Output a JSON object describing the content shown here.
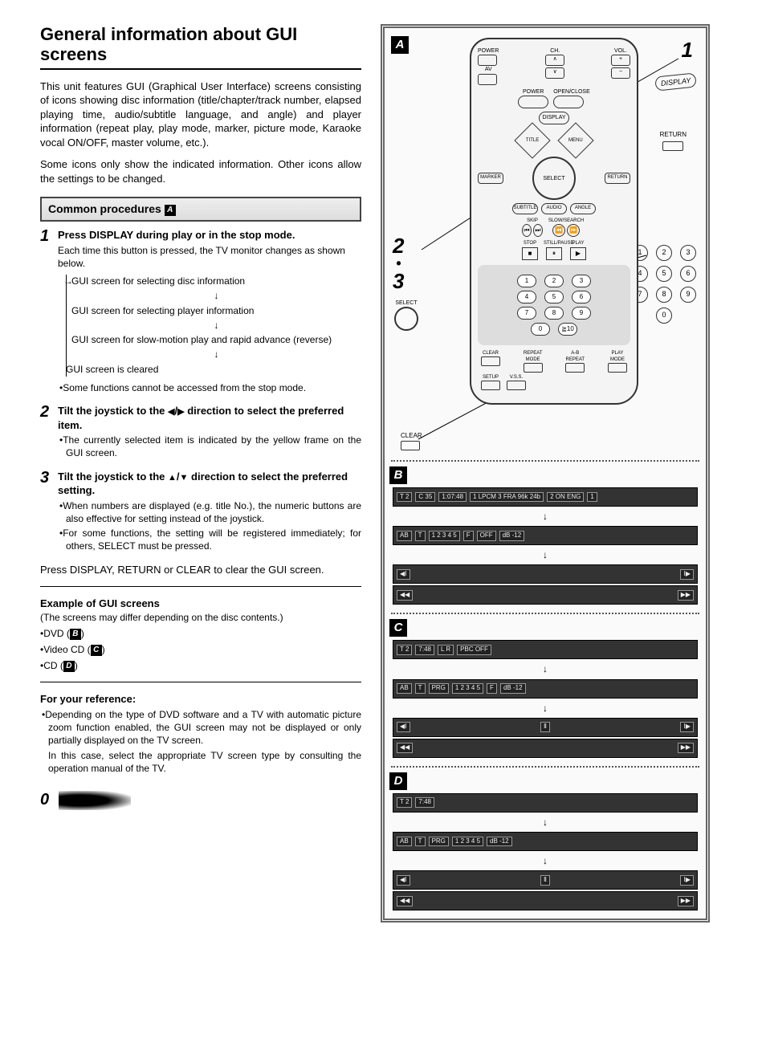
{
  "title_line1": "General information about GUI",
  "title_line2": "screens",
  "intro1": "This unit features GUI (Graphical User Interface) screens consisting of icons showing disc information (title/chapter/track number, elapsed playing time, audio/subtitle language, and angle) and player information (repeat play, play mode, marker, picture mode, Karaoke vocal ON/OFF, master volume, etc.).",
  "intro2": "Some icons only show the indicated information. Other icons allow the settings to be changed.",
  "section_header": "Common procedures",
  "section_badge": "A",
  "steps": [
    {
      "num": "1",
      "head": "Press DISPLAY during play or in the stop mode.",
      "sub": "Each time this button is pressed, the TV monitor changes as shown below.",
      "flow": [
        "GUI screen for selecting disc information",
        "GUI screen for selecting player information",
        "GUI screen for slow-motion play and rapid advance (reverse)",
        "GUI screen is cleared"
      ],
      "note": "Some functions cannot be accessed from the stop mode."
    },
    {
      "num": "2",
      "head_a": "Tilt the joystick to the ",
      "head_b": " direction to select the preferred item.",
      "note": "The currently selected item is indicated by the yellow frame on the GUI screen."
    },
    {
      "num": "3",
      "head_a": "Tilt the joystick to the ",
      "head_b": " direction to select the preferred setting.",
      "notes": [
        "When numbers are displayed (e.g. title No.), the numeric buttons are also effective for setting instead of the joystick.",
        "For some functions, the setting will be registered immediately; for others, SELECT must be pressed."
      ]
    }
  ],
  "press_clear": "Press DISPLAY, RETURN or CLEAR to clear the GUI screen.",
  "example_head": "Example of GUI screens",
  "example_note": "(The screens may differ depending on the disc contents.)",
  "examples": [
    {
      "label": "DVD",
      "ref": "B"
    },
    {
      "label": "Video CD",
      "ref": "C"
    },
    {
      "label": "CD",
      "ref": "D"
    }
  ],
  "ref_head": "For your reference:",
  "ref_body1": "Depending on the type of DVD software and a TV with automatic picture zoom function enabled, the GUI screen may not be displayed or only partially displayed on the TV screen.",
  "ref_body2": "In this case, select the appropriate TV screen type by consulting the operation manual of the TV.",
  "page_num": "0",
  "remote": {
    "top": {
      "power": "POWER",
      "ch": "CH.",
      "vol": "VOL.",
      "av": "AV"
    },
    "pair": {
      "power": "POWER",
      "open": "OPEN/CLOSE"
    },
    "display": "DISPLAY",
    "title": "TITLE",
    "menu": "MENU",
    "marker": "MARKER",
    "select": "SELECT",
    "return": "RETURN",
    "subtitle": "SUBTITLE",
    "audio": "AUDIO",
    "angle": "ANGLE",
    "skip": "SKIP",
    "slow": "SLOW/SEARCH",
    "stop": "STOP",
    "pause": "STILL/PAUSE",
    "play": "PLAY",
    "numbers": [
      "1",
      "2",
      "3",
      "4",
      "5",
      "6",
      "7",
      "8",
      "9",
      "0",
      "≧10"
    ],
    "bottom": {
      "clear": "CLEAR",
      "repeat": "REPEAT MODE",
      "ab": "A-B REPEAT",
      "playmode": "PLAY MODE",
      "setup": "SETUP",
      "vss": "V.S.S."
    }
  },
  "callouts": {
    "A": "A",
    "one": "1",
    "two": "2",
    "dot": "•",
    "three": "3",
    "display": "DISPLAY",
    "return": "RETURN",
    "select": "SELECT",
    "clear": "CLEAR",
    "B": "B",
    "C": "C",
    "D": "D"
  },
  "chart_data": {
    "type": "table",
    "note": "GUI bar icon readouts shown in manual diagram panels B, C, D",
    "panels": {
      "B_dvd": {
        "bar1": {
          "T": "2",
          "C": "35",
          "time": "1:07:48",
          "audio": "1",
          "audio_info": "LPCM 3 FRA 96k 24b",
          "sub": "2 ON ENG",
          "angle": "1"
        },
        "bar2": {
          "repeat": "AB",
          "T_repeat": "T",
          "marker": "1 2 3 4 5",
          "picture": "F",
          "karaoke": "OFF",
          "vol_db": "-12"
        },
        "bar3": "slow/rapid advance controls"
      },
      "C_vcd": {
        "bar1": {
          "T": "2",
          "time": "7:48",
          "audio": "L R",
          "pbc": "OFF"
        },
        "bar2": {
          "repeat": "AB",
          "T_repeat": "T",
          "mode": "PRG",
          "marker": "1 2 3 4 5",
          "picture": "F",
          "vol_db": "-12"
        },
        "bar3": "slow/rapid advance controls"
      },
      "D_cd": {
        "bar1": {
          "T": "2",
          "time": "7:48"
        },
        "bar2": {
          "repeat": "AB",
          "T_repeat": "T",
          "mode": "PRG",
          "marker": "1 2 3 4 5",
          "vol_db": "-12"
        },
        "bar3": "slow/rapid advance controls"
      }
    }
  }
}
